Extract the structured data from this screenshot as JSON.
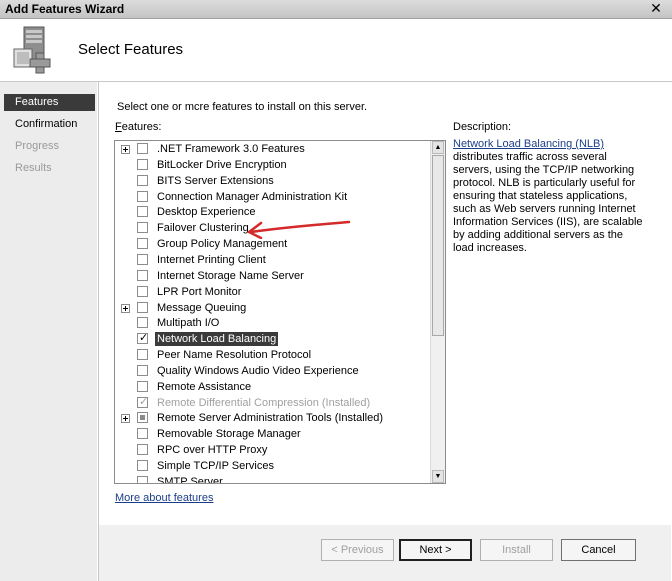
{
  "window": {
    "title": "Add Features Wizard",
    "close_glyph": "✕"
  },
  "header": {
    "heading": "Select Features"
  },
  "sidebar": {
    "items": [
      {
        "label": "Features",
        "state": "active"
      },
      {
        "label": "Confirmation",
        "state": "normal"
      },
      {
        "label": "Progress",
        "state": "disabled"
      },
      {
        "label": "Results",
        "state": "disabled"
      }
    ]
  },
  "main": {
    "instruction": "Select one or mcre features to install on this server.",
    "features_label_prefix": "F",
    "features_label_rest": "eatures:",
    "features": [
      {
        "label": ".NET Framework 3.0 Features",
        "expandable": true,
        "state": "unchecked"
      },
      {
        "label": "BitLocker Drive Encryption",
        "expandable": false,
        "state": "unchecked"
      },
      {
        "label": "BITS Server Extensions",
        "expandable": false,
        "state": "unchecked"
      },
      {
        "label": "Connection Manager Administration Kit",
        "expandable": false,
        "state": "unchecked"
      },
      {
        "label": "Desktop Experience",
        "expandable": false,
        "state": "unchecked"
      },
      {
        "label": "Failover Clustering",
        "expandable": false,
        "state": "unchecked"
      },
      {
        "label": "Group Policy Management",
        "expandable": false,
        "state": "unchecked"
      },
      {
        "label": "Internet Printing Client",
        "expandable": false,
        "state": "unchecked"
      },
      {
        "label": "Internet Storage Name Server",
        "expandable": false,
        "state": "unchecked"
      },
      {
        "label": "LPR Port Monitor",
        "expandable": false,
        "state": "unchecked"
      },
      {
        "label": "Message Queuing",
        "expandable": true,
        "state": "unchecked"
      },
      {
        "label": "Multipath I/O",
        "expandable": false,
        "state": "unchecked"
      },
      {
        "label": "Network Load Balancing",
        "expandable": false,
        "state": "checked",
        "selected": true
      },
      {
        "label": "Peer Name Resolution Protocol",
        "expandable": false,
        "state": "unchecked"
      },
      {
        "label": "Quality Windows Audio Video Experience",
        "expandable": false,
        "state": "unchecked"
      },
      {
        "label": "Remote Assistance",
        "expandable": false,
        "state": "unchecked"
      },
      {
        "label": "Remote Differential Compression  (Installed)",
        "expandable": false,
        "state": "checked-disabled"
      },
      {
        "label": "Remote Server Administration Tools  (Installed)",
        "expandable": true,
        "state": "partial"
      },
      {
        "label": "Removable Storage Manager",
        "expandable": false,
        "state": "unchecked"
      },
      {
        "label": "RPC over HTTP Proxy",
        "expandable": false,
        "state": "unchecked"
      },
      {
        "label": "Simple TCP/IP Services",
        "expandable": false,
        "state": "unchecked"
      },
      {
        "label": "SMTP Server",
        "expandable": false,
        "state": "unchecked"
      }
    ],
    "description_label": "Description:",
    "description_link": "Network Load Balancing (NLB)",
    "description_body": "distributes traffic across several servers, using the TCP/IP networking protocol. NLB is particularly useful for ensuring that stateless applications, such as Web servers running Internet Information Services (IIS), are scalable by adding additional servers as the load increases.",
    "more_link": "More about features"
  },
  "footer": {
    "previous_label": "< Previous",
    "next_label": "Next >",
    "install_label": "Install",
    "cancel_label": "Cancel"
  },
  "colors": {
    "annotation_arrow": "#d42a2a",
    "selection": "#3a3a3a",
    "link": "#1c3e8a"
  }
}
